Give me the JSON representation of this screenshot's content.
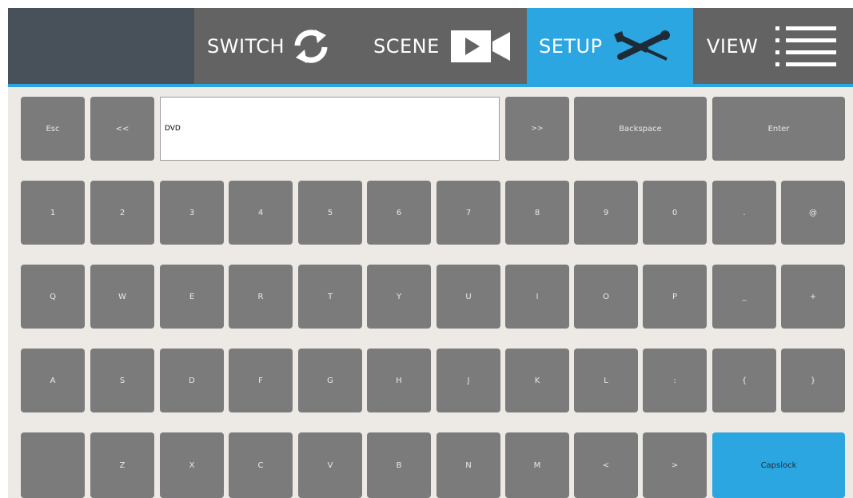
{
  "nav": {
    "switch_label": "SWITCH",
    "scene_label": "SCENE",
    "setup_label": "SETUP",
    "view_label": "VIEW",
    "active": "SETUP"
  },
  "colors": {
    "topbar_dark": "#48505a",
    "topbar_gray": "#636363",
    "accent_blue": "#2ca6e0",
    "key_gray": "#7b7b7b",
    "panel_bg": "#edeae6"
  },
  "icons": {
    "switch": "refresh-arrows-icon",
    "scene": "video-camera-icon",
    "setup": "wrench-screwdriver-icon",
    "view": "list-menu-icon"
  },
  "keyboard": {
    "text_value": "DVD",
    "row0": {
      "esc": "Esc",
      "prev": "<<",
      "next": ">>",
      "backspace": "Backspace",
      "enter": "Enter"
    },
    "row1": [
      "1",
      "2",
      "3",
      "4",
      "5",
      "6",
      "7",
      "8",
      "9",
      "0",
      ".",
      "@"
    ],
    "row2": [
      "Q",
      "W",
      "E",
      "R",
      "T",
      "Y",
      "U",
      "I",
      "O",
      "P",
      "_",
      "+"
    ],
    "row3": [
      "A",
      "S",
      "D",
      "F",
      "G",
      "H",
      "J",
      "K",
      "L",
      ":",
      "{",
      "}"
    ],
    "row4": [
      "",
      "Z",
      "X",
      "C",
      "V",
      "B",
      "N",
      "M",
      "<",
      ">"
    ],
    "capslock": "Capslock"
  }
}
